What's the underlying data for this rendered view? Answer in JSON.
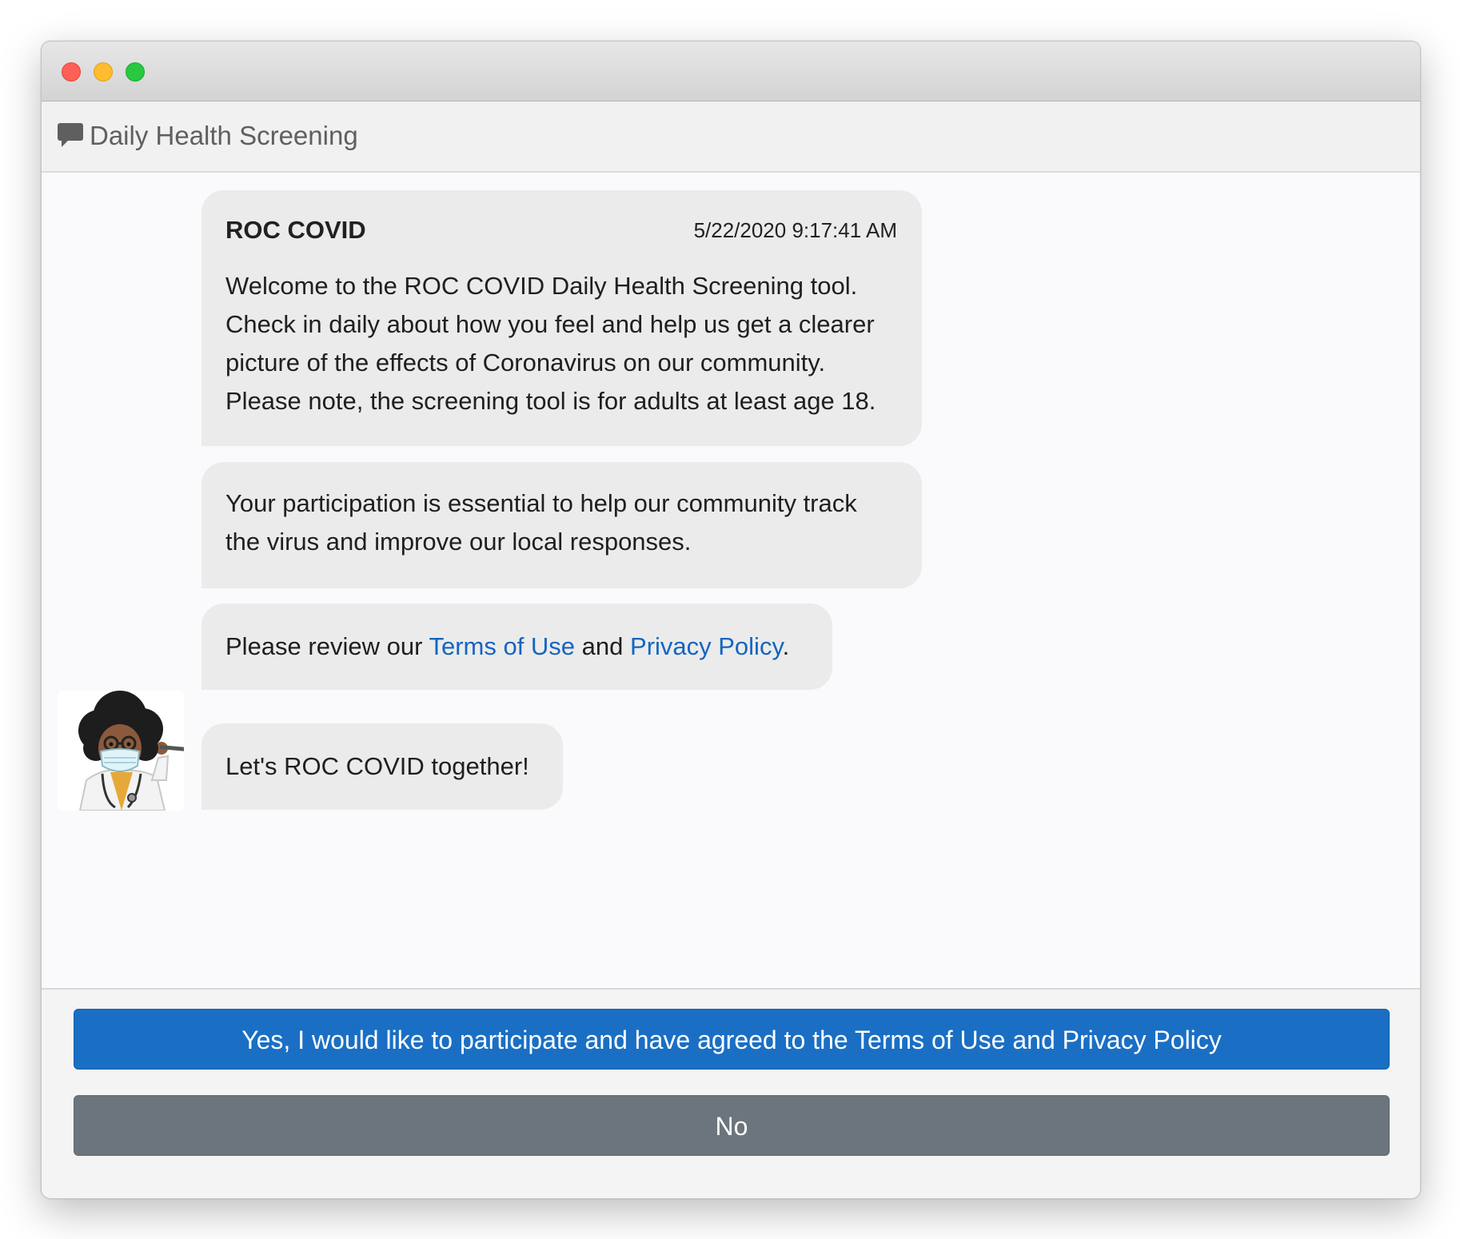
{
  "window": {
    "traffic_lights": [
      "close",
      "minimize",
      "zoom"
    ]
  },
  "header": {
    "icon": "chat-bubble-icon",
    "title": "Daily Health Screening"
  },
  "messages": {
    "first": {
      "sender": "ROC COVID",
      "timestamp": "5/22/2020 9:17:41 AM",
      "text": "Welcome to the ROC COVID Daily Health Screening tool.\nCheck in daily about how you feel and help us get a clearer\npicture of the effects of Coronavirus on our community.\nPlease note, the screening tool is for adults at least age 18."
    },
    "second": {
      "text": "Your participation is essential to help our community track\nthe virus and improve our local responses."
    },
    "third": {
      "prefix": "Please review our ",
      "terms_link": "Terms of Use",
      "middle": " and ",
      "privacy_link": "Privacy Policy",
      "suffix": "."
    },
    "fourth": {
      "text": "Let's ROC COVID together!"
    }
  },
  "avatar": {
    "icon": "doctor-avatar-icon"
  },
  "actions": {
    "yes_label": "Yes, I would like to participate and have agreed to the Terms of Use and Privacy Policy",
    "no_label": "No"
  },
  "colors": {
    "primary": "#1a6fc4",
    "secondary": "#6c757d",
    "link": "#1565c0",
    "bubble": "#ebebeb"
  }
}
